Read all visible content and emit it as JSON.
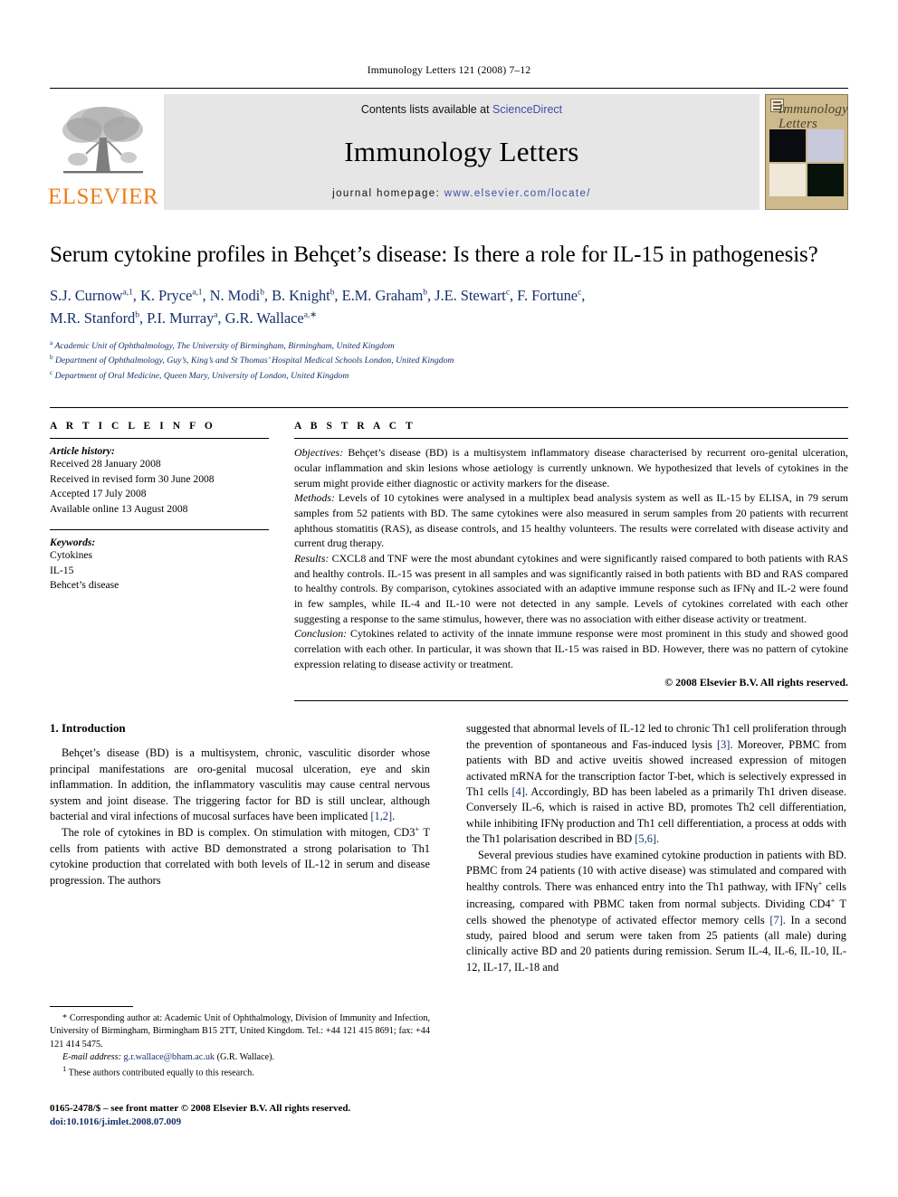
{
  "running_head": "Immunology Letters 121 (2008) 7–12",
  "masthead": {
    "publisher_wordmark": "ELSEVIER",
    "contents_prefix": "Contents lists available at ",
    "sciencedirect": "ScienceDirect",
    "journal_title": "Immunology Letters",
    "homepage_label": "journal homepage: ",
    "homepage_url": "www.elsevier.com/locate/",
    "cover_title_line1": "Immunology",
    "cover_title_line2": "Letters",
    "colors": {
      "elsevier_orange": "#ef7d1a",
      "link_blue": "#3a4fa8",
      "banner_grey": "#e6e6e6",
      "cover_tan": "#cdb98c"
    }
  },
  "article": {
    "title": "Serum cytokine profiles in Behçet’s disease: Is there a role for IL-15 in pathogenesis?",
    "authors": "S.J. Curnow a,1, K. Pryce a,1, N. Modi b, B. Knight b, E.M. Graham b, J.E. Stewart c, F. Fortune c, M.R. Stanford b, P.I. Murray a, G.R. Wallace a,*",
    "affiliations": [
      "a Academic Unit of Ophthalmology, The University of Birmingham, Birmingham, United Kingdom",
      "b Department of Ophthalmology, Guy’s, King’s and St Thomas’ Hospital Medical Schools London, United Kingdom",
      "c Department of Oral Medicine, Queen Mary, University of London, United Kingdom"
    ]
  },
  "article_info": {
    "heading": "A R T I C L E    I N F O",
    "history_label": "Article history:",
    "history": [
      "Received 28 January 2008",
      "Received in revised form 30 June 2008",
      "Accepted 17 July 2008",
      "Available online 13 August 2008"
    ],
    "keywords_label": "Keywords:",
    "keywords": [
      "Cytokines",
      "IL-15",
      "Behcet’s disease"
    ]
  },
  "abstract": {
    "heading": "A B S T R A C T",
    "objectives_label": "Objectives:",
    "objectives": " Behçet’s disease (BD) is a multisystem inflammatory disease characterised by recurrent oro-genital ulceration, ocular inflammation and skin lesions whose aetiology is currently unknown. We hypothesized that levels of cytokines in the serum might provide either diagnostic or activity markers for the disease.",
    "methods_label": "Methods:",
    "methods": " Levels of 10 cytokines were analysed in a multiplex bead analysis system as well as IL-15 by ELISA, in 79 serum samples from 52 patients with BD. The same cytokines were also measured in serum samples from 20 patients with recurrent aphthous stomatitis (RAS), as disease controls, and 15 healthy volunteers. The results were correlated with disease activity and current drug therapy.",
    "results_label": "Results:",
    "results": " CXCL8 and TNF were the most abundant cytokines and were significantly raised compared to both patients with RAS and healthy controls. IL-15 was present in all samples and was significantly raised in both patients with BD and RAS compared to healthy controls. By comparison, cytokines associated with an adaptive immune response such as IFNγ and IL-2 were found in few samples, while IL-4 and IL-10 were not detected in any sample. Levels of cytokines correlated with each other suggesting a response to the same stimulus, however, there was no association with either disease activity or treatment.",
    "conclusion_label": "Conclusion:",
    "conclusion": " Cytokines related to activity of the innate immune response were most prominent in this study and showed good correlation with each other. In particular, it was shown that IL-15 was raised in BD. However, there was no pattern of cytokine expression relating to disease activity or treatment.",
    "copyright": "© 2008 Elsevier B.V. All rights reserved."
  },
  "body": {
    "section_heading": "1.  Introduction",
    "left_p1_a": "Behçet’s disease (BD) is a multisystem, chronic, vasculitic disorder whose principal manifestations are oro-genital mucosal ulceration, eye and skin inflammation. In addition, the inflammatory vasculitis may cause central nervous system and joint disease. The triggering factor for BD is still unclear, although bacterial and viral infections of mucosal surfaces have been implicated ",
    "left_p1_cite": "[1,2]",
    "left_p1_b": ".",
    "left_p2": "The role of cytokines in BD is complex. On stimulation with mitogen, CD3",
    "left_p2_sup": "+",
    "left_p2_b": " T cells from patients with active BD demonstrated a strong polarisation to Th1 cytokine production that correlated with both levels of IL-12 in serum and disease progression. The authors",
    "right_p1_a": "suggested that abnormal levels of IL-12 led to chronic Th1 cell proliferation through the prevention of spontaneous and Fas-induced lysis ",
    "right_cite_3": "[3]",
    "right_p1_b": ". Moreover, PBMC from patients with BD and active uveitis showed increased expression of mitogen activated mRNA for the transcription factor T-bet, which is selectively expressed in Th1 cells ",
    "right_cite_4": "[4]",
    "right_p1_c": ". Accordingly, BD has been labeled as a primarily Th1 driven disease. Conversely IL-6, which is raised in active BD, promotes Th2 cell differentiation, while inhibiting IFNγ production and Th1 cell differentiation, a process at odds with the Th1 polarisation described in BD ",
    "right_cite_56": "[5,6]",
    "right_p1_d": ".",
    "right_p2_a": "Several previous studies have examined cytokine production in patients with BD. PBMC from 24 patients (10 with active disease) was stimulated and compared with healthy controls. There was enhanced entry into the Th1 pathway, with IFNγ",
    "right_p2_sup1": "+",
    "right_p2_b": " cells increasing, compared with PBMC taken from normal subjects. Dividing CD4",
    "right_p2_sup2": "+",
    "right_p2_c": " T cells showed the phenotype of activated effector memory cells ",
    "right_cite_7": "[7]",
    "right_p2_d": ". In a second study, paired blood and serum were taken from 25 patients (all male) during clinically active BD and 20 patients during remission. Serum IL-4, IL-6, IL-10, IL-12, IL-17, IL-18 and"
  },
  "footnotes": {
    "corresponding_marker": "*",
    "corresponding": "  Corresponding author at: Academic Unit of Ophthalmology, Division of Immunity and Infection, University of Birmingham, Birmingham B15 2TT, United Kingdom. Tel.: +44 121 415 8691; fax: +44 121 414 5475.",
    "email_label": "E-mail address:",
    "email": " g.r.wallace@bham.ac.uk",
    "email_suffix": " (G.R. Wallace).",
    "note_marker": "1",
    "note": "  These authors contributed equally to this research.",
    "issn_line": "0165-2478/$ – see front matter © 2008 Elsevier B.V. All rights reserved.",
    "doi_line": "doi:10.1016/j.imlet.2008.07.009"
  }
}
